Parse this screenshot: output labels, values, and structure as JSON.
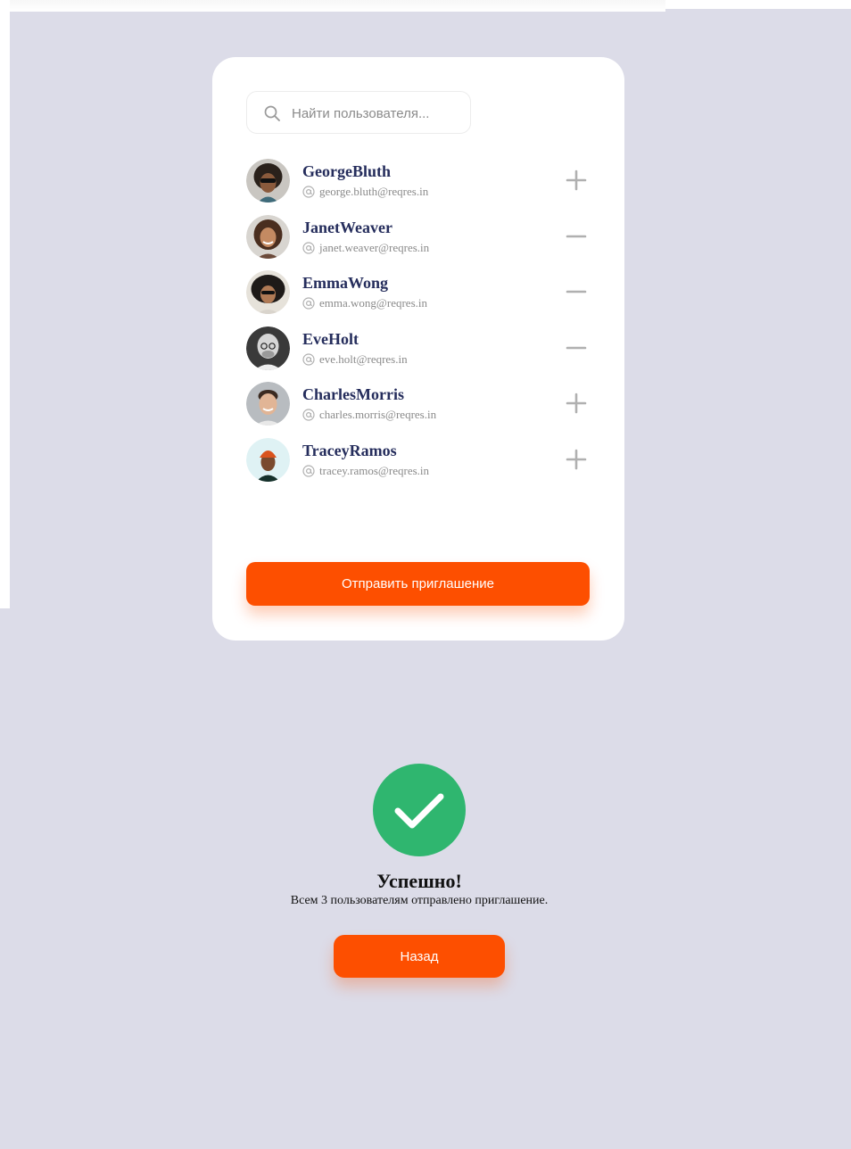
{
  "search": {
    "placeholder": "Найти пользователя...",
    "value": ""
  },
  "users": [
    {
      "name": "GeorgeBluth",
      "email": "george.bluth@reqres.in",
      "action": "plus",
      "avatar_bg": "#c9c6c1"
    },
    {
      "name": "JanetWeaver",
      "email": "janet.weaver@reqres.in",
      "action": "minus",
      "avatar_bg": "#d8d5d0"
    },
    {
      "name": "EmmaWong",
      "email": "emma.wong@reqres.in",
      "action": "minus",
      "avatar_bg": "#e6e2da"
    },
    {
      "name": "EveHolt",
      "email": "eve.holt@reqres.in",
      "action": "minus",
      "avatar_bg": "#3a3a3a"
    },
    {
      "name": "CharlesMorris",
      "email": "charles.morris@reqres.in",
      "action": "plus",
      "avatar_bg": "#b8bcc0"
    },
    {
      "name": "TraceyRamos",
      "email": "tracey.ramos@reqres.in",
      "action": "plus",
      "avatar_bg": "#dff2f4"
    }
  ],
  "send_button": {
    "label": "Отправить приглашение"
  },
  "success": {
    "title": "Успешно!",
    "message": "Всем 3 пользователям отправлено приглашение.",
    "back_label": "Назад"
  },
  "colors": {
    "background": "#dcdce8",
    "accent": "#fd4f00",
    "success": "#2fb66f",
    "name_text": "#252d5c",
    "icon_gray": "#b0b0b0"
  },
  "icons": {
    "search": "search-icon",
    "email": "at-icon",
    "add": "plus-icon",
    "remove": "minus-icon",
    "success": "checkmark-icon"
  }
}
